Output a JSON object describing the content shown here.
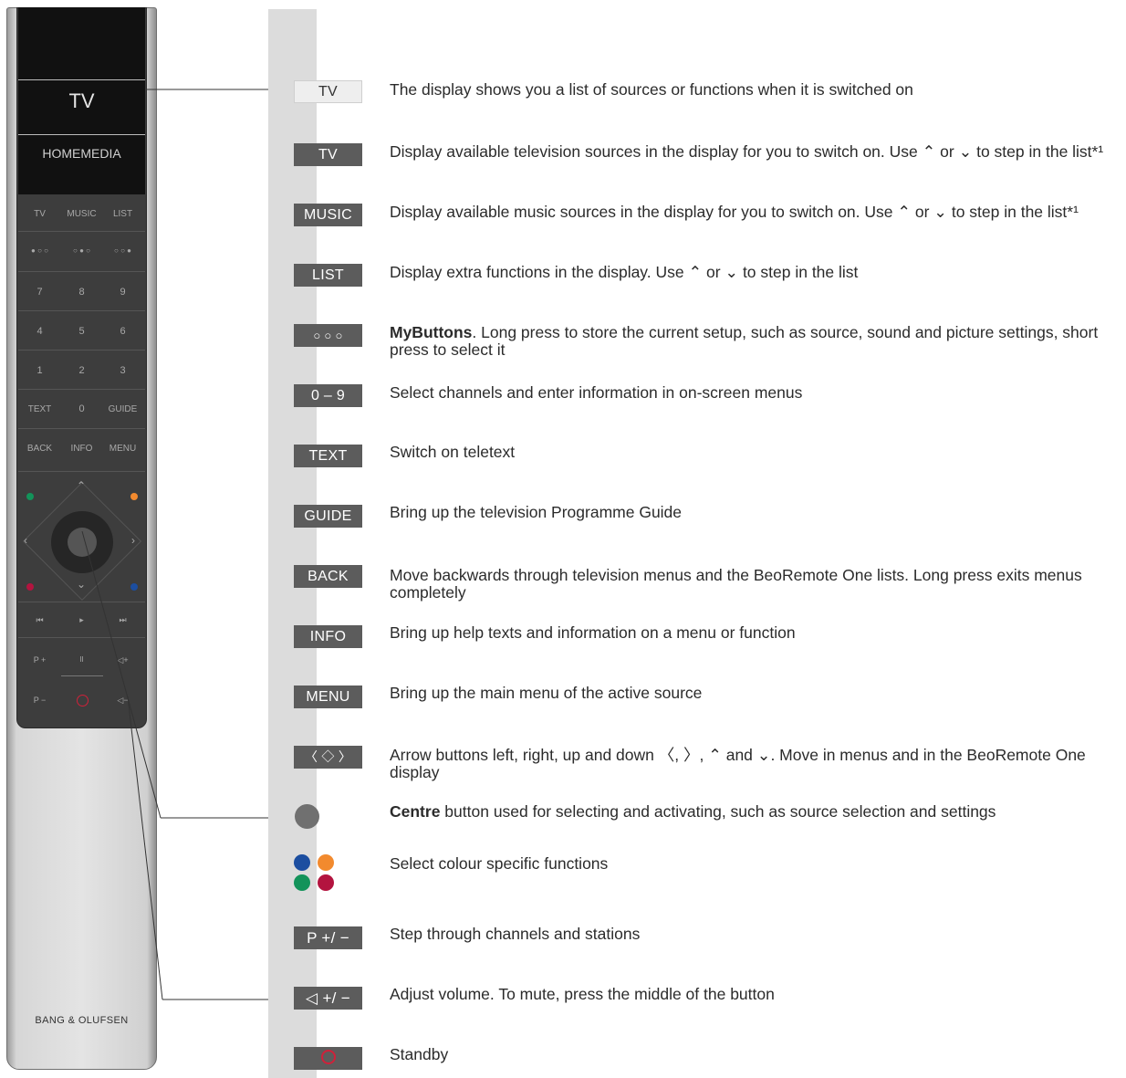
{
  "remote": {
    "display": {
      "primary": "TV",
      "secondary": "HOMEMEDIA"
    },
    "source_keys": [
      "TV",
      "MUSIC",
      "LIST"
    ],
    "mybuttons": [
      "● ○ ○",
      "○ ● ○",
      "○ ○ ●"
    ],
    "num_rows": [
      [
        "7",
        "8",
        "9"
      ],
      [
        "4",
        "5",
        "6"
      ],
      [
        "1",
        "2",
        "3"
      ]
    ],
    "text_row": [
      "TEXT",
      "0",
      "GUIDE"
    ],
    "back_row": [
      "BACK",
      "INFO",
      "MENU"
    ],
    "transport": [
      "⏮",
      "▸",
      "⏭"
    ],
    "p_plus": "P +",
    "pause": "II",
    "vol_plus": "◁+",
    "p_minus": "P −",
    "vol_minus": "◁−",
    "brand": "BANG & OLUFSEN"
  },
  "rows": [
    {
      "chip": "TV",
      "chip_style": "light",
      "text": "The display shows you a list of sources or functions when it is switched on"
    },
    {
      "chip": "TV",
      "text": "Display available television sources in the display for you to switch on. Use ⌃ or ⌄ to step in the list*¹"
    },
    {
      "chip": "MUSIC",
      "text": "Display available music sources in the display for you to switch on. Use ⌃ or ⌄ to step in the list*¹"
    },
    {
      "chip": "LIST",
      "text": "Display extra functions in the display. Use ⌃ or ⌄ to step in the list"
    },
    {
      "chip": "○ ○ ○",
      "bold": "MyButtons",
      "text": ". Long press to store the current setup, such as source, sound and picture settings, short press to select it"
    },
    {
      "chip": "0 – 9",
      "text": "Select channels and enter information in on-screen menus"
    },
    {
      "chip": "TEXT",
      "text": "Switch on teletext"
    },
    {
      "chip": "GUIDE",
      "text": "Bring up the television Programme Guide"
    },
    {
      "chip": "BACK",
      "text": "Move backwards through television menus and the BeoRemote One lists. Long press exits menus completely"
    },
    {
      "chip": "INFO",
      "text": "Bring up help texts and information on a menu or function"
    },
    {
      "chip": "MENU",
      "text": "Bring up the main menu of the active source"
    },
    {
      "chip": "〈 ◇ 〉",
      "text": "Arrow buttons left, right, up and down 〈, 〉, ⌃ and ⌄. Move in menus and in the BeoRemote One display"
    },
    {
      "bold": "Centre",
      "text": " button used for selecting and activating, such as source selection and settings"
    },
    {
      "text": "Select colour specific functions"
    },
    {
      "chip": "P +/ −",
      "text": "Step through channels and stations"
    },
    {
      "chip": "◁ +/ −",
      "text": "Adjust volume. To mute, press the middle of the button"
    },
    {
      "text": "Standby"
    }
  ],
  "colors": {
    "green": "#13935a",
    "orange": "#f28a2e",
    "red": "#b3143f",
    "blue": "#1c4ea0",
    "standby": "#d0213a"
  }
}
